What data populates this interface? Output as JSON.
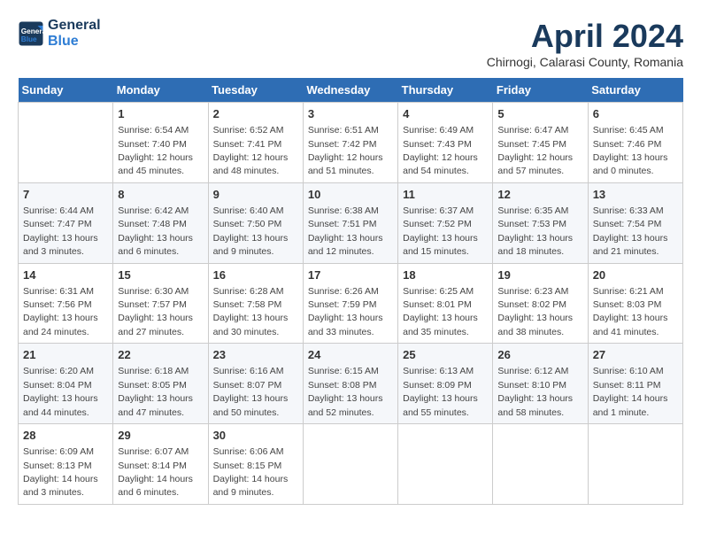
{
  "header": {
    "logo_line1": "General",
    "logo_line2": "Blue",
    "month": "April 2024",
    "location": "Chirnogi, Calarasi County, Romania"
  },
  "weekdays": [
    "Sunday",
    "Monday",
    "Tuesday",
    "Wednesday",
    "Thursday",
    "Friday",
    "Saturday"
  ],
  "weeks": [
    [
      {
        "day": "",
        "info": ""
      },
      {
        "day": "1",
        "info": "Sunrise: 6:54 AM\nSunset: 7:40 PM\nDaylight: 12 hours\nand 45 minutes."
      },
      {
        "day": "2",
        "info": "Sunrise: 6:52 AM\nSunset: 7:41 PM\nDaylight: 12 hours\nand 48 minutes."
      },
      {
        "day": "3",
        "info": "Sunrise: 6:51 AM\nSunset: 7:42 PM\nDaylight: 12 hours\nand 51 minutes."
      },
      {
        "day": "4",
        "info": "Sunrise: 6:49 AM\nSunset: 7:43 PM\nDaylight: 12 hours\nand 54 minutes."
      },
      {
        "day": "5",
        "info": "Sunrise: 6:47 AM\nSunset: 7:45 PM\nDaylight: 12 hours\nand 57 minutes."
      },
      {
        "day": "6",
        "info": "Sunrise: 6:45 AM\nSunset: 7:46 PM\nDaylight: 13 hours\nand 0 minutes."
      }
    ],
    [
      {
        "day": "7",
        "info": "Sunrise: 6:44 AM\nSunset: 7:47 PM\nDaylight: 13 hours\nand 3 minutes."
      },
      {
        "day": "8",
        "info": "Sunrise: 6:42 AM\nSunset: 7:48 PM\nDaylight: 13 hours\nand 6 minutes."
      },
      {
        "day": "9",
        "info": "Sunrise: 6:40 AM\nSunset: 7:50 PM\nDaylight: 13 hours\nand 9 minutes."
      },
      {
        "day": "10",
        "info": "Sunrise: 6:38 AM\nSunset: 7:51 PM\nDaylight: 13 hours\nand 12 minutes."
      },
      {
        "day": "11",
        "info": "Sunrise: 6:37 AM\nSunset: 7:52 PM\nDaylight: 13 hours\nand 15 minutes."
      },
      {
        "day": "12",
        "info": "Sunrise: 6:35 AM\nSunset: 7:53 PM\nDaylight: 13 hours\nand 18 minutes."
      },
      {
        "day": "13",
        "info": "Sunrise: 6:33 AM\nSunset: 7:54 PM\nDaylight: 13 hours\nand 21 minutes."
      }
    ],
    [
      {
        "day": "14",
        "info": "Sunrise: 6:31 AM\nSunset: 7:56 PM\nDaylight: 13 hours\nand 24 minutes."
      },
      {
        "day": "15",
        "info": "Sunrise: 6:30 AM\nSunset: 7:57 PM\nDaylight: 13 hours\nand 27 minutes."
      },
      {
        "day": "16",
        "info": "Sunrise: 6:28 AM\nSunset: 7:58 PM\nDaylight: 13 hours\nand 30 minutes."
      },
      {
        "day": "17",
        "info": "Sunrise: 6:26 AM\nSunset: 7:59 PM\nDaylight: 13 hours\nand 33 minutes."
      },
      {
        "day": "18",
        "info": "Sunrise: 6:25 AM\nSunset: 8:01 PM\nDaylight: 13 hours\nand 35 minutes."
      },
      {
        "day": "19",
        "info": "Sunrise: 6:23 AM\nSunset: 8:02 PM\nDaylight: 13 hours\nand 38 minutes."
      },
      {
        "day": "20",
        "info": "Sunrise: 6:21 AM\nSunset: 8:03 PM\nDaylight: 13 hours\nand 41 minutes."
      }
    ],
    [
      {
        "day": "21",
        "info": "Sunrise: 6:20 AM\nSunset: 8:04 PM\nDaylight: 13 hours\nand 44 minutes."
      },
      {
        "day": "22",
        "info": "Sunrise: 6:18 AM\nSunset: 8:05 PM\nDaylight: 13 hours\nand 47 minutes."
      },
      {
        "day": "23",
        "info": "Sunrise: 6:16 AM\nSunset: 8:07 PM\nDaylight: 13 hours\nand 50 minutes."
      },
      {
        "day": "24",
        "info": "Sunrise: 6:15 AM\nSunset: 8:08 PM\nDaylight: 13 hours\nand 52 minutes."
      },
      {
        "day": "25",
        "info": "Sunrise: 6:13 AM\nSunset: 8:09 PM\nDaylight: 13 hours\nand 55 minutes."
      },
      {
        "day": "26",
        "info": "Sunrise: 6:12 AM\nSunset: 8:10 PM\nDaylight: 13 hours\nand 58 minutes."
      },
      {
        "day": "27",
        "info": "Sunrise: 6:10 AM\nSunset: 8:11 PM\nDaylight: 14 hours\nand 1 minute."
      }
    ],
    [
      {
        "day": "28",
        "info": "Sunrise: 6:09 AM\nSunset: 8:13 PM\nDaylight: 14 hours\nand 3 minutes."
      },
      {
        "day": "29",
        "info": "Sunrise: 6:07 AM\nSunset: 8:14 PM\nDaylight: 14 hours\nand 6 minutes."
      },
      {
        "day": "30",
        "info": "Sunrise: 6:06 AM\nSunset: 8:15 PM\nDaylight: 14 hours\nand 9 minutes."
      },
      {
        "day": "",
        "info": ""
      },
      {
        "day": "",
        "info": ""
      },
      {
        "day": "",
        "info": ""
      },
      {
        "day": "",
        "info": ""
      }
    ]
  ]
}
